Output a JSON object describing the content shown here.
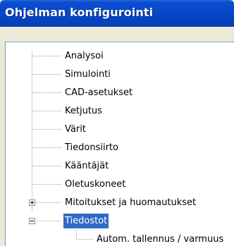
{
  "window": {
    "title": "Ohjelman konfigurointi"
  },
  "tree": {
    "items": [
      {
        "label": "Analysoi"
      },
      {
        "label": "Simulointi"
      },
      {
        "label": "CAD-asetukset"
      },
      {
        "label": "Ketjutus"
      },
      {
        "label": "Värit"
      },
      {
        "label": "Tiedonsiirto"
      },
      {
        "label": "Kääntäjät"
      },
      {
        "label": "Oletuskoneet"
      },
      {
        "label": "Mitoitukset ja huomautukset",
        "expander": "collapsed"
      },
      {
        "label": "Tiedostot",
        "expander": "expanded",
        "selected": true
      },
      {
        "label": "Autom. tallennus / varmuus"
      }
    ]
  },
  "colors": {
    "title_bar": "#0747c8",
    "selection": "#316ac5",
    "tree_lines": "#a0a0a0"
  },
  "icons": {
    "collapsed": "plus-box-icon",
    "expanded": "minus-box-icon"
  }
}
